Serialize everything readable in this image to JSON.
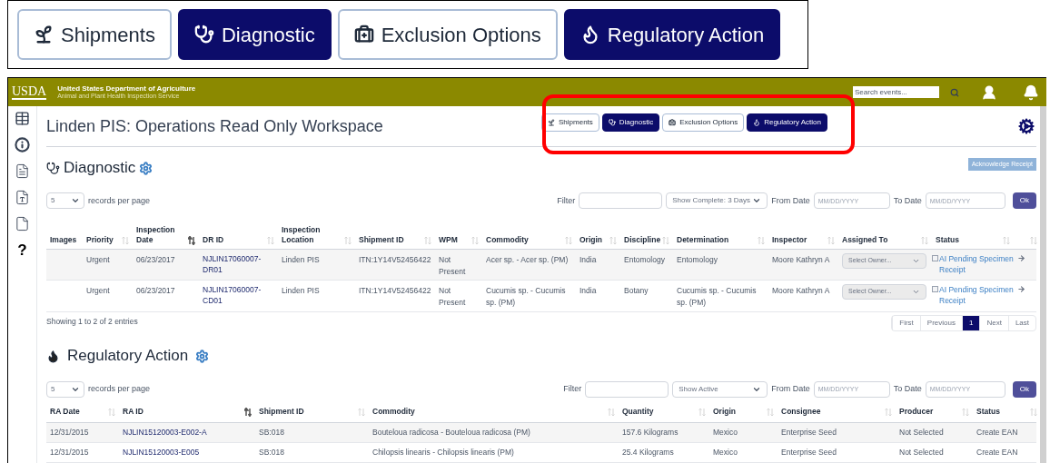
{
  "zoom_tabs": [
    {
      "label": "Shipments",
      "selected": false
    },
    {
      "label": "Diagnostic",
      "selected": true
    },
    {
      "label": "Exclusion Options",
      "selected": false
    },
    {
      "label": "Regulatory Action",
      "selected": true
    }
  ],
  "header": {
    "logo": "USDA",
    "agency": "United States Department of Agriculture",
    "subagency": "Animal and Plant Health Inspection Service",
    "search": {
      "placeholder": "Search events..."
    }
  },
  "sidebar": {
    "help": "?"
  },
  "workspace": {
    "title": "Linden PIS: Operations Read Only Workspace",
    "tabs": [
      {
        "label": "Shipments",
        "selected": false
      },
      {
        "label": "Diagnostic",
        "selected": true
      },
      {
        "label": "Exclusion Options",
        "selected": false
      },
      {
        "label": "Regulatory Action",
        "selected": true
      }
    ]
  },
  "diagnostic": {
    "title": "Diagnostic",
    "action_button": "Acknowledge Receipt",
    "page_size": "5",
    "page_size_label": "records per page",
    "filter_label": "Filter",
    "show_select": "Show Complete: 3 Days",
    "from_label": "From Date",
    "from_placeholder": "MM/DD/YYYY",
    "to_label": "To Date",
    "to_placeholder": "MM/DD/YYYY",
    "ok": "Ok",
    "columns": [
      {
        "label": "Images",
        "sortable": false
      },
      {
        "label": "Priority",
        "sortable": true,
        "sorted": false
      },
      {
        "label": "Inspection Date",
        "sortable": true,
        "sorted": true
      },
      {
        "label": "DR ID",
        "sortable": true,
        "sorted": false
      },
      {
        "label": "Inspection Location",
        "sortable": true,
        "sorted": false
      },
      {
        "label": "Shipment ID",
        "sortable": true,
        "sorted": false
      },
      {
        "label": "WPM",
        "sortable": true,
        "sorted": false
      },
      {
        "label": "Commodity",
        "sortable": true,
        "sorted": false
      },
      {
        "label": "Origin",
        "sortable": true,
        "sorted": false
      },
      {
        "label": "Discipline",
        "sortable": true,
        "sorted": false
      },
      {
        "label": "Determination",
        "sortable": true,
        "sorted": false
      },
      {
        "label": "Inspector",
        "sortable": true,
        "sorted": false
      },
      {
        "label": "Assigned To",
        "sortable": true,
        "sorted": false
      },
      {
        "label": "Status",
        "sortable": true,
        "sorted": false
      },
      {
        "sortable": true,
        "sorted": false
      }
    ],
    "rows": [
      {
        "priority": "Urgent",
        "inspection_date": "06/23/2017",
        "dr_id": "NJLIN17060007-DR01",
        "location": "Linden PIS",
        "shipment_id": "ITN:1Y14V52456422",
        "wpm": "Not Present",
        "commodity": "Acer sp. - Acer sp. (PM)",
        "origin": "India",
        "discipline": "Entomology",
        "determination": "Entomology",
        "inspector": "Moore Kathryn A",
        "owner_placeholder": "Select Owner...",
        "status_checked": false,
        "status": "AI Pending Specimen Receipt"
      },
      {
        "priority": "Urgent",
        "inspection_date": "06/23/2017",
        "dr_id": "NJLIN17060007-CD01",
        "location": "Linden PIS",
        "shipment_id": "ITN:1Y14V52456422",
        "wpm": "Not Present",
        "commodity": "Cucumis sp. - Cucumis sp. (PM)",
        "origin": "India",
        "discipline": "Botany",
        "determination": "Cucumis sp. - Cucumis sp. (PM)",
        "inspector": "Moore Kathryn A",
        "owner_placeholder": "Select Owner...",
        "status_checked": false,
        "status": "AI Pending Specimen Receipt"
      }
    ],
    "info": "Showing 1 to 2 of 2 entries",
    "pagination": [
      {
        "label": "First",
        "selected": false
      },
      {
        "label": "Previous",
        "selected": false
      },
      {
        "label": "1",
        "selected": true
      },
      {
        "label": "Next",
        "selected": false
      },
      {
        "label": "Last",
        "selected": false
      }
    ]
  },
  "regulatory": {
    "title": "Regulatory Action",
    "page_size": "5",
    "page_size_label": "records per page",
    "filter_label": "Filter",
    "show_select": "Show Active",
    "from_label": "From Date",
    "from_placeholder": "MM/DD/YYYY",
    "to_label": "To Date",
    "to_placeholder": "MM/DD/YYYY",
    "ok": "Ok",
    "columns": [
      {
        "label": "RA Date",
        "sortable": true,
        "sorted": false
      },
      {
        "label": "RA ID",
        "sortable": true,
        "sorted": true
      },
      {
        "label": "Shipment ID",
        "sortable": true,
        "sorted": false
      },
      {
        "label": "Commodity",
        "sortable": true,
        "sorted": false
      },
      {
        "label": "Quantity",
        "sortable": true,
        "sorted": false
      },
      {
        "label": "Origin",
        "sortable": true,
        "sorted": false
      },
      {
        "label": "Consignee",
        "sortable": true,
        "sorted": false
      },
      {
        "label": "Producer",
        "sortable": true,
        "sorted": false
      },
      {
        "label": "Status",
        "sortable": true,
        "sorted": false
      }
    ],
    "rows": [
      {
        "ra_date": "12/31/2015",
        "ra_id": "NJLIN15120003-E002-A",
        "shipment_id": "SB:018",
        "commodity": "Bouteloua radicosa - Bouteloua radicosa (PM)",
        "quantity": "157.6 Kilograms",
        "origin": "Mexico",
        "consignee": "Enterprise Seed",
        "producer": "Not Selected",
        "status": "Create EAN"
      },
      {
        "ra_date": "12/31/2015",
        "ra_id": "NJLIN15120003-E005",
        "shipment_id": "SB:018",
        "commodity": "Chilopsis linearis - Chilopsis linearis (PM)",
        "quantity": "25.4 Kilograms",
        "origin": "Mexico",
        "consignee": "Enterprise Seed",
        "producer": "Not Selected",
        "status": "Create EAN"
      }
    ]
  }
}
